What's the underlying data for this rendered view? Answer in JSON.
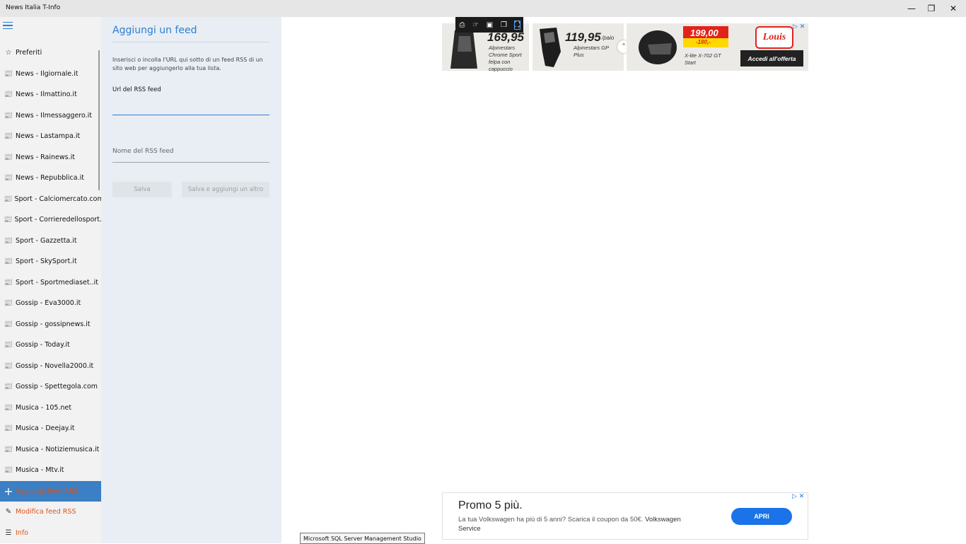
{
  "window": {
    "title": "News Italia T-Info",
    "minimize": "—",
    "restore": "❐",
    "close": "✕"
  },
  "sidebar": {
    "items": [
      {
        "label": "Preferiti",
        "icon": "☆",
        "icon_name": "star-icon"
      },
      {
        "label": "News - Ilgiornale.it",
        "icon": "📰",
        "icon_name": "news-icon"
      },
      {
        "label": "News - Ilmattino.it",
        "icon": "📰",
        "icon_name": "news-icon"
      },
      {
        "label": "News - Ilmessaggero.it",
        "icon": "📰",
        "icon_name": "news-icon"
      },
      {
        "label": "News - Lastampa.it",
        "icon": "📰",
        "icon_name": "news-icon"
      },
      {
        "label": "News - Rainews.it",
        "icon": "📰",
        "icon_name": "news-icon"
      },
      {
        "label": "News - Repubblica.it",
        "icon": "📰",
        "icon_name": "news-icon"
      },
      {
        "label": "Sport - Calciomercato.com",
        "icon": "📰",
        "icon_name": "news-icon"
      },
      {
        "label": "Sport - Corrieredellosport.it",
        "icon": "📰",
        "icon_name": "news-icon"
      },
      {
        "label": "Sport - Gazzetta.it",
        "icon": "📰",
        "icon_name": "news-icon"
      },
      {
        "label": "Sport - SkySport.it",
        "icon": "📰",
        "icon_name": "news-icon"
      },
      {
        "label": "Sport - Sportmediaset..it",
        "icon": "📰",
        "icon_name": "news-icon"
      },
      {
        "label": "Gossip - Eva3000.it",
        "icon": "📰",
        "icon_name": "news-icon"
      },
      {
        "label": "Gossip - gossipnews.it",
        "icon": "📰",
        "icon_name": "news-icon"
      },
      {
        "label": "Gossip - Today.it",
        "icon": "📰",
        "icon_name": "news-icon"
      },
      {
        "label": "Gossip - Novella2000.it",
        "icon": "📰",
        "icon_name": "news-icon"
      },
      {
        "label": "Gossip - Spettegola.com",
        "icon": "📰",
        "icon_name": "news-icon"
      },
      {
        "label": "Musica - 105.net",
        "icon": "📰",
        "icon_name": "news-icon"
      },
      {
        "label": "Musica - Deejay.it",
        "icon": "📰",
        "icon_name": "news-icon"
      },
      {
        "label": "Musica - Notiziemusica.it",
        "icon": "📰",
        "icon_name": "news-icon"
      },
      {
        "label": "Musica - Mtv.it",
        "icon": "📰",
        "icon_name": "news-icon"
      },
      {
        "label": "Aggiungi feed RSS",
        "icon": "+",
        "icon_name": "plus-icon"
      },
      {
        "label": "Modifica feed RSS",
        "icon": "✎",
        "icon_name": "pencil-icon"
      },
      {
        "label": "Info",
        "icon": "☰",
        "icon_name": "info-list-icon"
      }
    ]
  },
  "panel": {
    "title": "Aggiungi un feed",
    "description": "Inserisci o incolla l'URL  qui sotto di un feed RSS di un sito web per aggiungerlo alla tua lista.",
    "url_label": "Url del RSS feed",
    "url_value": "",
    "name_placeholder": "Nome del RSS feed",
    "save_label": "Salva",
    "save_add_label": "Salva e aggiungi un altro"
  },
  "ad_top": {
    "price1": "169,95",
    "product1": "Alpinestars Chrome Sport felpa con cappuccio",
    "price2": "119,95",
    "price2_unit": "/paio",
    "product2": "Alpinestars GP Plus",
    "price3": "199,00",
    "discount3": "-180,-",
    "product3": "X-lite X-702 GT Start",
    "brand": "Louis",
    "cta": "Accedi all'offerta",
    "adchoices": "▷ ✕"
  },
  "ad_bottom": {
    "headline": "Promo 5 più.",
    "body": "La tua Volkswagen ha più di 5 anni? Scarica il coupon da 50€.",
    "advertiser": "Volkswagen Service",
    "cta": "APRI",
    "adchoices": "▷ ✕"
  },
  "tooltip": "Microsoft SQL Server Management Studio",
  "colors": {
    "accent": "#2e7dd2",
    "active_bg": "#3b7fc4",
    "orange_text": "#d8561f"
  }
}
